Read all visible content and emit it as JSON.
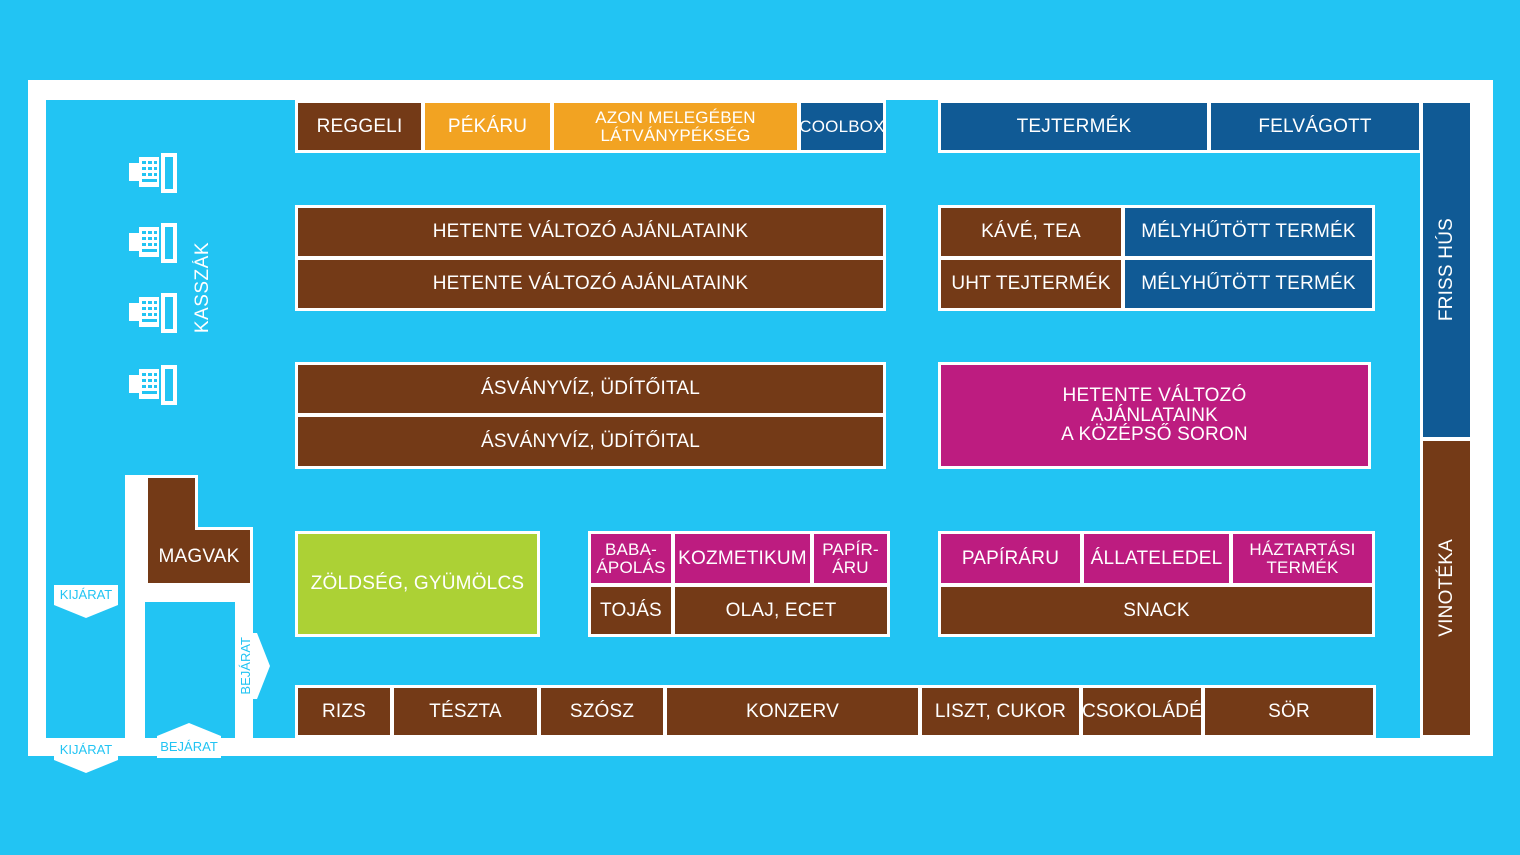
{
  "colors": {
    "background": "#22c4f3",
    "wall": "#ffffff",
    "brown": "#743a17",
    "orange": "#f2a322",
    "blue": "#105a95",
    "magenta": "#bd1c80",
    "green": "#acd135"
  },
  "top_row": {
    "reggeli": "REGGELI",
    "pekaru": "PÉKÁRU",
    "latvanypekseg": "AZON MELEGÉBEN\nLÁTVÁNYPÉKSÉG",
    "coolbox": "COOLBOX",
    "tejtermek": "TEJTERMÉK",
    "felvagott": "FELVÁGOTT"
  },
  "aisle1": {
    "top": "HETENTE VÁLTOZÓ AJÁNLATAINK",
    "bottom": "HETENTE VÁLTOZÓ AJÁNLATAINK"
  },
  "aisle1_right": {
    "kave_tea": "KÁVÉ, TEA",
    "melyhutott_1": "MÉLYHŰTÖTT TERMÉK",
    "uht": "UHT TEJTERMÉK",
    "melyhutott_2": "MÉLYHŰTÖTT TERMÉK"
  },
  "aisle2": {
    "top": "ÁSVÁNYVÍZ, ÜDÍTŐITAL",
    "bottom": "ÁSVÁNYVÍZ, ÜDÍTŐITAL"
  },
  "middle_offer": "HETENTE VÁLTOZÓ\nAJÁNLATAINK\nA KÖZÉPSŐ SORON",
  "aisle3": {
    "zoldseg": "ZÖLDSÉG, GYÜMÖLCS",
    "baba": "BABA-\nÁPOLÁS",
    "kozmetikum": "KOZMETIKUM",
    "papir_aru": "PAPÍR-\nÁRU",
    "tojas": "TOJÁS",
    "olaj": "OLAJ, ECET",
    "papiraru": "PAPÍRÁRU",
    "allateledel": "ÁLLATELEDEL",
    "haztartasi": "HÁZTARTÁSI\nTERMÉK",
    "snack": "SNACK"
  },
  "bottom_row": {
    "rizs": "RIZS",
    "teszta": "TÉSZTA",
    "szosz": "SZÓSZ",
    "konzerv": "KONZERV",
    "liszt": "LISZT, CUKOR",
    "csokolade": "CSOKOLÁDÉ",
    "sor": "SÖR"
  },
  "right_wall": {
    "friss_hus": "FRISS HÚS",
    "vinoteka": "VINOTÉKA"
  },
  "left_area": {
    "kasszak": "KASSZÁK",
    "magvak": "MAGVAK",
    "kijarat_1": "KIJÁRAT",
    "kijarat_2": "KIJÁRAT",
    "bejarat_1": "BEJÁRAT",
    "bejarat_2": "BEJÁRAT"
  },
  "icons": {
    "register": "cash-register-icon"
  }
}
